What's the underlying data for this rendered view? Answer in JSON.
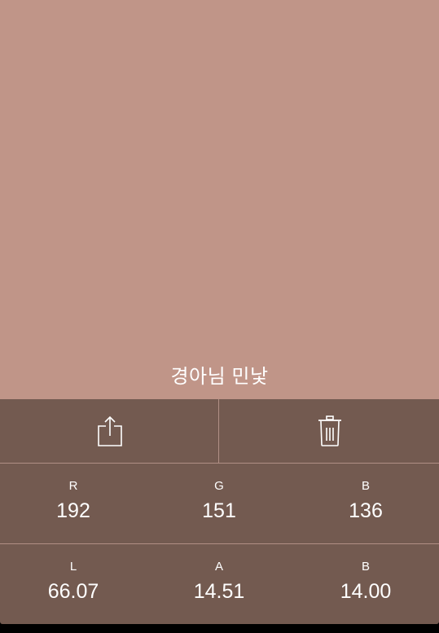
{
  "colors": {
    "swatch": "#c09588",
    "panel": "#735a50",
    "divider": "#b08f85",
    "text": "#ffffff"
  },
  "color_name": "경아님 민낯",
  "actions": {
    "share_icon": "share-icon",
    "delete_icon": "trash-icon"
  },
  "rgb": [
    {
      "label": "R",
      "value": "192"
    },
    {
      "label": "G",
      "value": "151"
    },
    {
      "label": "B",
      "value": "136"
    }
  ],
  "lab": [
    {
      "label": "L",
      "value": "66.07"
    },
    {
      "label": "A",
      "value": "14.51"
    },
    {
      "label": "B",
      "value": "14.00"
    }
  ]
}
